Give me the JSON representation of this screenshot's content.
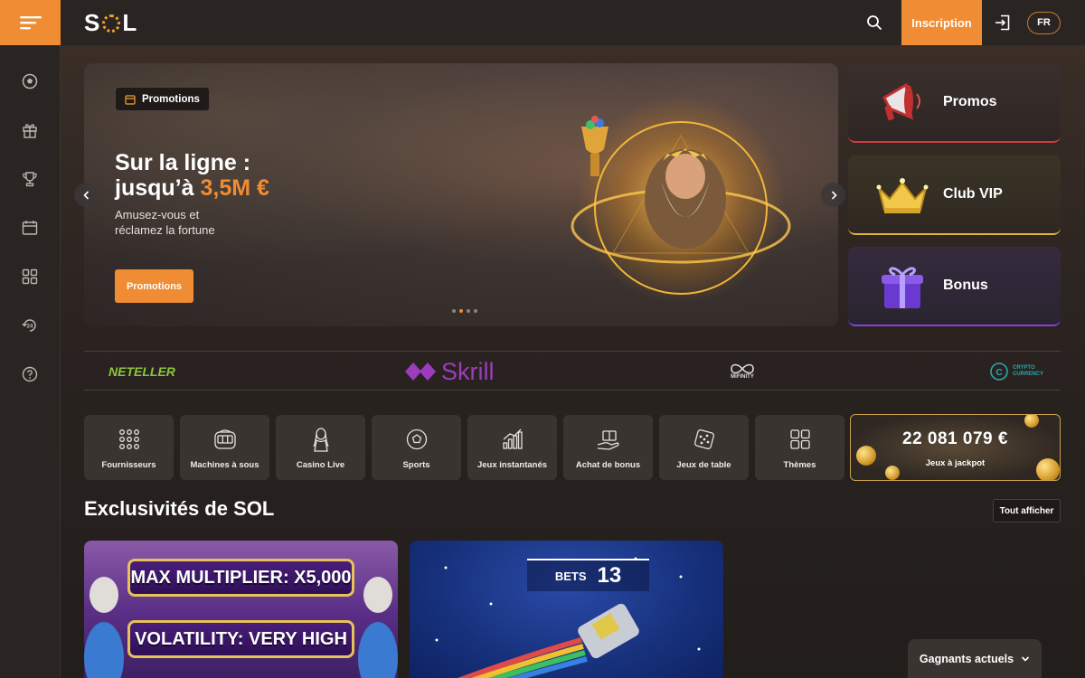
{
  "header": {
    "logo_text_left": "S",
    "logo_text_right": "L",
    "signup_label": "Inscription",
    "language": "FR"
  },
  "sidebar": {
    "items": [
      {
        "icon": "soccer-ball-icon"
      },
      {
        "icon": "gift-icon"
      },
      {
        "icon": "trophy-icon"
      },
      {
        "icon": "calendar-icon"
      },
      {
        "icon": "grid-icon"
      },
      {
        "icon": "support-24-icon"
      },
      {
        "icon": "help-icon"
      }
    ]
  },
  "hero": {
    "tag": "Promotions",
    "title_line1": "Sur la ligne :",
    "title_line2_prefix": "jusqu’à ",
    "title_line2_accent": "3,5M €",
    "subtitle": "Amusez-vous et réclamez la fortune",
    "cta": "Promotions"
  },
  "side_promos": [
    {
      "label": "Promos",
      "accent": "#d33a3a"
    },
    {
      "label": "Club VIP",
      "accent": "#e0b43c"
    },
    {
      "label": "Bonus",
      "accent": "#8a3de0"
    }
  ],
  "payments": {
    "neteller": "NETELLER",
    "skrill": "Skrill",
    "mifinity": "MiFINITY",
    "crypto_line1": "CRYPTO",
    "crypto_line2": "CURRENCY"
  },
  "categories": [
    {
      "label": "Fournisseurs",
      "icon": "providers-dots-icon"
    },
    {
      "label": "Machines à sous",
      "icon": "slot-machine-icon"
    },
    {
      "label": "Casino Live",
      "icon": "live-dealer-icon"
    },
    {
      "label": "Sports",
      "icon": "soccer-ball-icon"
    },
    {
      "label": "Jeux instantanés",
      "icon": "bar-chart-icon"
    },
    {
      "label": "Achat de bonus",
      "icon": "gift-hand-icon"
    },
    {
      "label": "Jeux de table",
      "icon": "dice-icon"
    },
    {
      "label": "Thèmes",
      "icon": "themes-grid-icon"
    }
  ],
  "jackpot": {
    "amount": "22 081 079 €",
    "label": "Jeux à jackpot"
  },
  "section": {
    "title": "Exclusivités de SOL",
    "see_all": "Tout afficher"
  },
  "games": {
    "game1_line1": "MAX MULTIPLIER: X5,000",
    "game1_line2": "VOLATILITY: VERY HIGH",
    "game2_bets_label": "BETS",
    "game2_bets_value": "13"
  },
  "winners": {
    "label": "Gagnants actuels"
  },
  "colors": {
    "accent": "#f08c33",
    "background": "#241f1d"
  }
}
